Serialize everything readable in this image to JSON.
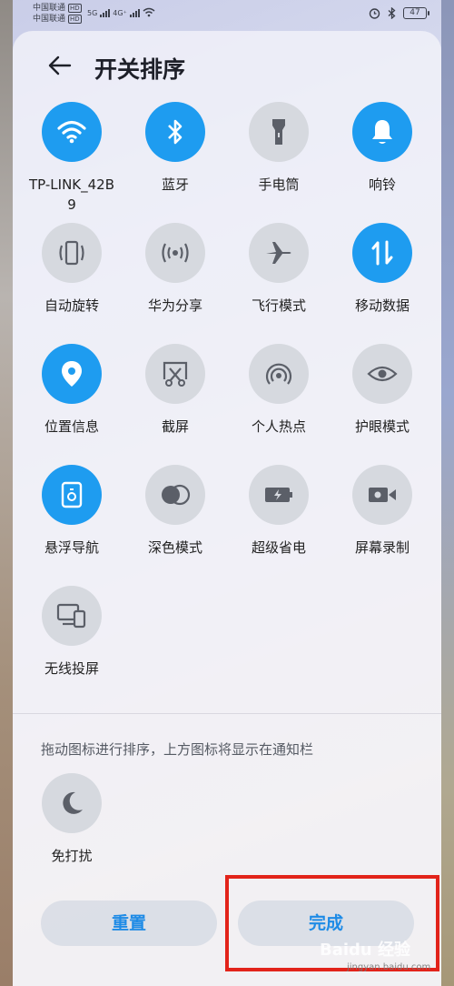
{
  "status_bar": {
    "carrier1": "中国联通",
    "carrier2": "中国联通",
    "hd": "HD",
    "net1": "5G",
    "net2": "4G⁺",
    "battery": "47"
  },
  "header": {
    "title": "开关排序"
  },
  "tiles": [
    {
      "label": "TP-LINK_42B9",
      "state": "on",
      "icon": "wifi-icon"
    },
    {
      "label": "蓝牙",
      "state": "on",
      "icon": "bluetooth-icon"
    },
    {
      "label": "手电筒",
      "state": "off",
      "icon": "flashlight-icon"
    },
    {
      "label": "响铃",
      "state": "on",
      "icon": "bell-icon"
    },
    {
      "label": "自动旋转",
      "state": "off",
      "icon": "auto-rotate-icon"
    },
    {
      "label": "华为分享",
      "state": "off",
      "icon": "share-icon"
    },
    {
      "label": "飞行模式",
      "state": "off",
      "icon": "airplane-icon"
    },
    {
      "label": "移动数据",
      "state": "on",
      "icon": "mobile-data-icon"
    },
    {
      "label": "位置信息",
      "state": "on",
      "icon": "location-icon"
    },
    {
      "label": "截屏",
      "state": "off",
      "icon": "screenshot-icon"
    },
    {
      "label": "个人热点",
      "state": "off",
      "icon": "hotspot-icon"
    },
    {
      "label": "护眼模式",
      "state": "off",
      "icon": "eye-icon"
    },
    {
      "label": "悬浮导航",
      "state": "on",
      "icon": "float-nav-icon"
    },
    {
      "label": "深色模式",
      "state": "off",
      "icon": "dark-mode-icon"
    },
    {
      "label": "超级省电",
      "state": "off",
      "icon": "power-saving-icon"
    },
    {
      "label": "屏幕录制",
      "state": "off",
      "icon": "screen-record-icon"
    },
    {
      "label": "无线投屏",
      "state": "off",
      "icon": "wireless-projection-icon"
    }
  ],
  "hint": "拖动图标进行排序，上方图标将显示在通知栏",
  "bottom_tiles": [
    {
      "label": "免打扰",
      "state": "off",
      "icon": "moon-icon"
    }
  ],
  "buttons": {
    "reset": "重置",
    "done": "完成"
  },
  "watermark": {
    "main": "Baidu 经验",
    "sub": "jingyan.baidu.com"
  },
  "colors": {
    "accent": "#1e9cf0",
    "highlight": "#e2231a"
  }
}
